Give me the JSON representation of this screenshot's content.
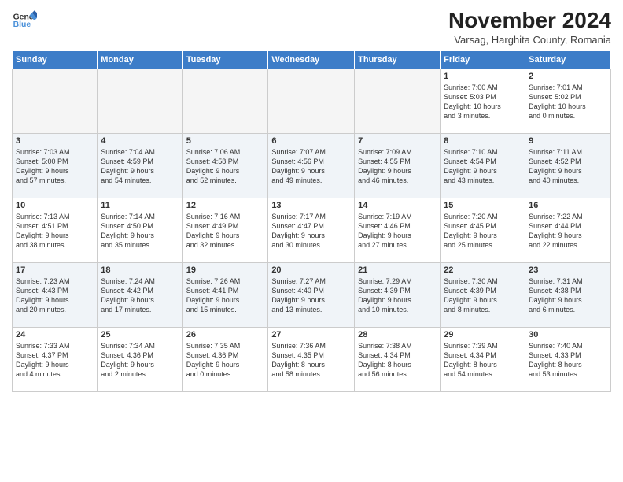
{
  "header": {
    "logo_line1": "General",
    "logo_line2": "Blue",
    "month": "November 2024",
    "location": "Varsag, Harghita County, Romania"
  },
  "weekdays": [
    "Sunday",
    "Monday",
    "Tuesday",
    "Wednesday",
    "Thursday",
    "Friday",
    "Saturday"
  ],
  "weeks": [
    [
      {
        "day": "",
        "empty": true
      },
      {
        "day": "",
        "empty": true
      },
      {
        "day": "",
        "empty": true
      },
      {
        "day": "",
        "empty": true
      },
      {
        "day": "",
        "empty": true
      },
      {
        "day": "1",
        "info": "Sunrise: 7:00 AM\nSunset: 5:03 PM\nDaylight: 10 hours\nand 3 minutes."
      },
      {
        "day": "2",
        "info": "Sunrise: 7:01 AM\nSunset: 5:02 PM\nDaylight: 10 hours\nand 0 minutes."
      }
    ],
    [
      {
        "day": "3",
        "info": "Sunrise: 7:03 AM\nSunset: 5:00 PM\nDaylight: 9 hours\nand 57 minutes."
      },
      {
        "day": "4",
        "info": "Sunrise: 7:04 AM\nSunset: 4:59 PM\nDaylight: 9 hours\nand 54 minutes."
      },
      {
        "day": "5",
        "info": "Sunrise: 7:06 AM\nSunset: 4:58 PM\nDaylight: 9 hours\nand 52 minutes."
      },
      {
        "day": "6",
        "info": "Sunrise: 7:07 AM\nSunset: 4:56 PM\nDaylight: 9 hours\nand 49 minutes."
      },
      {
        "day": "7",
        "info": "Sunrise: 7:09 AM\nSunset: 4:55 PM\nDaylight: 9 hours\nand 46 minutes."
      },
      {
        "day": "8",
        "info": "Sunrise: 7:10 AM\nSunset: 4:54 PM\nDaylight: 9 hours\nand 43 minutes."
      },
      {
        "day": "9",
        "info": "Sunrise: 7:11 AM\nSunset: 4:52 PM\nDaylight: 9 hours\nand 40 minutes."
      }
    ],
    [
      {
        "day": "10",
        "info": "Sunrise: 7:13 AM\nSunset: 4:51 PM\nDaylight: 9 hours\nand 38 minutes."
      },
      {
        "day": "11",
        "info": "Sunrise: 7:14 AM\nSunset: 4:50 PM\nDaylight: 9 hours\nand 35 minutes."
      },
      {
        "day": "12",
        "info": "Sunrise: 7:16 AM\nSunset: 4:49 PM\nDaylight: 9 hours\nand 32 minutes."
      },
      {
        "day": "13",
        "info": "Sunrise: 7:17 AM\nSunset: 4:47 PM\nDaylight: 9 hours\nand 30 minutes."
      },
      {
        "day": "14",
        "info": "Sunrise: 7:19 AM\nSunset: 4:46 PM\nDaylight: 9 hours\nand 27 minutes."
      },
      {
        "day": "15",
        "info": "Sunrise: 7:20 AM\nSunset: 4:45 PM\nDaylight: 9 hours\nand 25 minutes."
      },
      {
        "day": "16",
        "info": "Sunrise: 7:22 AM\nSunset: 4:44 PM\nDaylight: 9 hours\nand 22 minutes."
      }
    ],
    [
      {
        "day": "17",
        "info": "Sunrise: 7:23 AM\nSunset: 4:43 PM\nDaylight: 9 hours\nand 20 minutes."
      },
      {
        "day": "18",
        "info": "Sunrise: 7:24 AM\nSunset: 4:42 PM\nDaylight: 9 hours\nand 17 minutes."
      },
      {
        "day": "19",
        "info": "Sunrise: 7:26 AM\nSunset: 4:41 PM\nDaylight: 9 hours\nand 15 minutes."
      },
      {
        "day": "20",
        "info": "Sunrise: 7:27 AM\nSunset: 4:40 PM\nDaylight: 9 hours\nand 13 minutes."
      },
      {
        "day": "21",
        "info": "Sunrise: 7:29 AM\nSunset: 4:39 PM\nDaylight: 9 hours\nand 10 minutes."
      },
      {
        "day": "22",
        "info": "Sunrise: 7:30 AM\nSunset: 4:39 PM\nDaylight: 9 hours\nand 8 minutes."
      },
      {
        "day": "23",
        "info": "Sunrise: 7:31 AM\nSunset: 4:38 PM\nDaylight: 9 hours\nand 6 minutes."
      }
    ],
    [
      {
        "day": "24",
        "info": "Sunrise: 7:33 AM\nSunset: 4:37 PM\nDaylight: 9 hours\nand 4 minutes."
      },
      {
        "day": "25",
        "info": "Sunrise: 7:34 AM\nSunset: 4:36 PM\nDaylight: 9 hours\nand 2 minutes."
      },
      {
        "day": "26",
        "info": "Sunrise: 7:35 AM\nSunset: 4:36 PM\nDaylight: 9 hours\nand 0 minutes."
      },
      {
        "day": "27",
        "info": "Sunrise: 7:36 AM\nSunset: 4:35 PM\nDaylight: 8 hours\nand 58 minutes."
      },
      {
        "day": "28",
        "info": "Sunrise: 7:38 AM\nSunset: 4:34 PM\nDaylight: 8 hours\nand 56 minutes."
      },
      {
        "day": "29",
        "info": "Sunrise: 7:39 AM\nSunset: 4:34 PM\nDaylight: 8 hours\nand 54 minutes."
      },
      {
        "day": "30",
        "info": "Sunrise: 7:40 AM\nSunset: 4:33 PM\nDaylight: 8 hours\nand 53 minutes."
      }
    ]
  ]
}
